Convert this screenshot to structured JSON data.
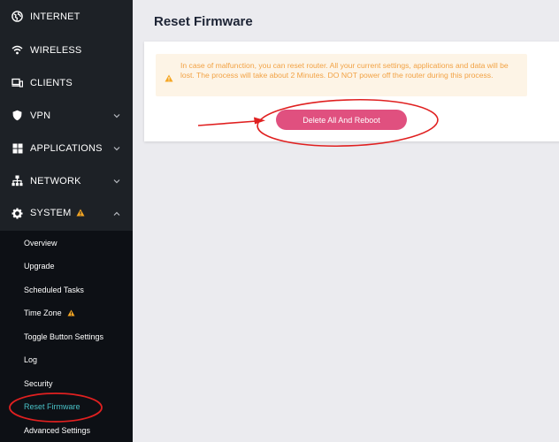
{
  "sidebar": {
    "items": [
      {
        "label": "INTERNET",
        "icon": "globe-icon"
      },
      {
        "label": "WIRELESS",
        "icon": "wifi-icon"
      },
      {
        "label": "CLIENTS",
        "icon": "devices-icon"
      },
      {
        "label": "VPN",
        "icon": "shield-icon"
      },
      {
        "label": "APPLICATIONS",
        "icon": "grid-icon"
      },
      {
        "label": "NETWORK",
        "icon": "network-icon"
      },
      {
        "label": "SYSTEM",
        "icon": "gear-icon",
        "warning": true,
        "expanded": true
      }
    ],
    "submenu": [
      {
        "label": "Overview"
      },
      {
        "label": "Upgrade"
      },
      {
        "label": "Scheduled Tasks"
      },
      {
        "label": "Time Zone",
        "warning": true
      },
      {
        "label": "Toggle Button Settings"
      },
      {
        "label": "Log"
      },
      {
        "label": "Security"
      },
      {
        "label": "Reset Firmware",
        "active": true
      },
      {
        "label": "Advanced Settings"
      }
    ]
  },
  "main": {
    "title": "Reset Firmware",
    "alert_text": "In case of malfunction, you can reset router. All your current settings, applications and data will be lost. The process will take about 2 Minutes. DO NOT power off the router during this process.",
    "button_label": "Delete All And Reboot"
  },
  "colors": {
    "sidebar_bg": "#1d2126",
    "submenu_bg": "#0d1015",
    "active_item": "#49c2c7",
    "button": "#e0507f",
    "alert_bg": "#fdf4e6",
    "alert_text": "#f2a244",
    "warning_icon": "#f5a623",
    "annotation": "#e02020"
  }
}
